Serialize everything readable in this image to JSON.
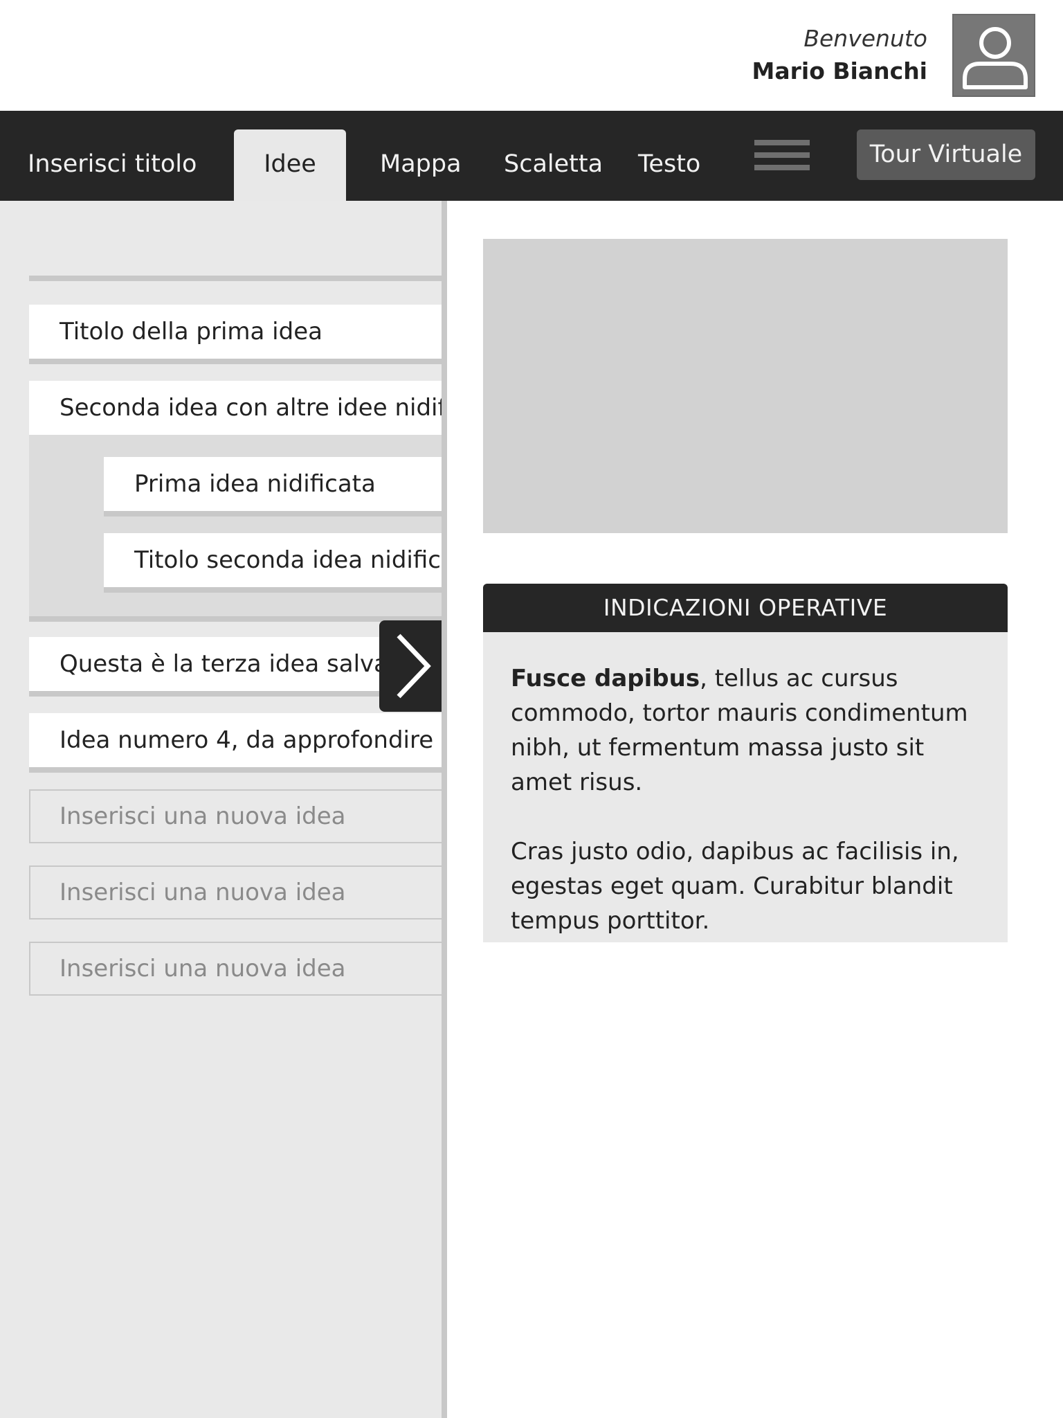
{
  "header": {
    "welcome_label": "Benvenuto",
    "user_name": "Mario Bianchi",
    "avatar_icon": "user-icon"
  },
  "navbar": {
    "title": "Inserisci titolo",
    "tabs": [
      {
        "label": "Idee",
        "active": true
      },
      {
        "label": "Mappa",
        "active": false
      },
      {
        "label": "Scaletta",
        "active": false
      },
      {
        "label": "Testo",
        "active": false
      }
    ],
    "menu_icon": "hamburger-icon",
    "tour_button": "Tour Virtuale"
  },
  "ideas": {
    "items": [
      "Titolo della prima idea",
      "Seconda idea con altre idee nidificate",
      "Questa è la terza idea salvata",
      "Idea numero 4, da approfondire"
    ],
    "nested": [
      "Prima idea nidificata",
      "Titolo seconda idea nidificata"
    ],
    "new_placeholders": [
      "Inserisci una nuova idea",
      "Inserisci una nuova idea",
      "Inserisci una nuova idea"
    ],
    "expand_icon": "chevron-right-icon"
  },
  "info": {
    "title": "INDICAZIONI OPERATIVE",
    "p1_bold": "Fusce dapibus",
    "p1_rest": ", tellus ac cursus commodo, tortor mauris condimentum nibh, ut fermentum massa justo sit amet risus.",
    "p2": "Cras justo odio, dapibus ac facilisis in, egestas eget quam. Curabitur blandit tempus porttitor."
  },
  "colors": {
    "dark": "#262626",
    "panel": "#e9e9e9",
    "rule": "#c8c8c8",
    "placeholder": "#d2d2d2"
  }
}
